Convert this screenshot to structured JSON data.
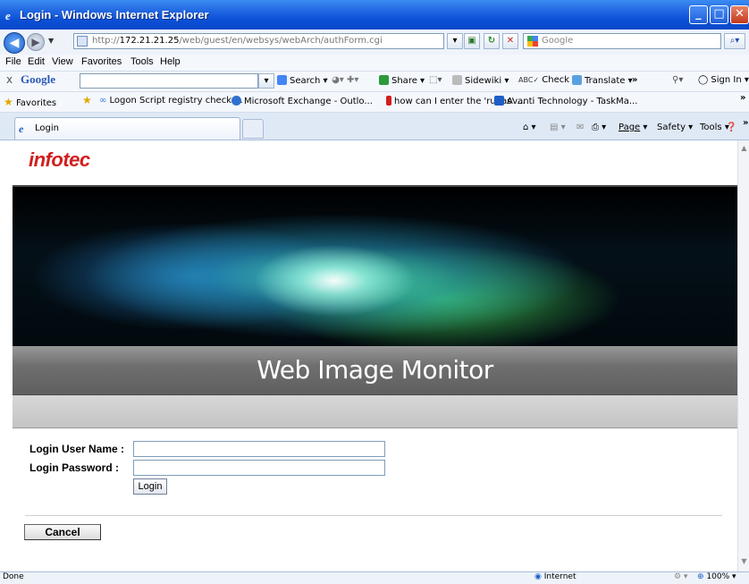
{
  "window": {
    "title": "Login - Windows Internet Explorer"
  },
  "address": {
    "url_prefix": "http://",
    "url_host": "172.21.21.25",
    "url_path": "/web/guest/en/websys/webArch/authForm.cgi",
    "search_placeholder": "Google"
  },
  "menu": [
    "File",
    "Edit",
    "View",
    "Favorites",
    "Tools",
    "Help"
  ],
  "google_toolbar": {
    "close": "x",
    "logo": "Google",
    "search": "Search",
    "share": "Share",
    "sidewiki": "Sidewiki",
    "check": "Check",
    "translate": "Translate",
    "more": "»",
    "sign_in": "Sign In"
  },
  "favorites": {
    "label": "Favorites",
    "items": [
      "Logon Script registry check ...",
      "Microsoft Exchange - Outlo...",
      "how can I enter the 'runas' ...",
      "Avanti Technology - TaskMa..."
    ],
    "more": "»"
  },
  "tabs": {
    "active": "Login"
  },
  "command_bar": {
    "page": "Page",
    "safety": "Safety",
    "tools": "Tools",
    "more": "»"
  },
  "page": {
    "logo": "infotec",
    "banner_title": "Web Image Monitor",
    "form": {
      "username_label": "Login User Name :",
      "password_label": "Login Password :",
      "username_value": "",
      "password_value": "",
      "login_button": "Login",
      "cancel_button": "Cancel"
    }
  },
  "status": {
    "text": "Done",
    "zone": "Internet",
    "zoom": "100%"
  },
  "colors": {
    "title_bar": "#0b4fd6",
    "logo": "#d21e1e",
    "banner_strip": "#6f6f6f"
  }
}
